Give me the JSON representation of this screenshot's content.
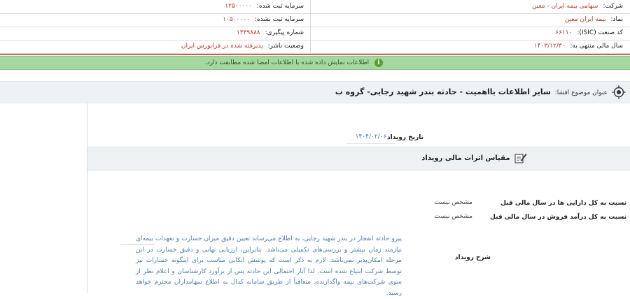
{
  "company_info": {
    "company": {
      "label": "شرکت:",
      "value": "سهامی بیمه ایران - معین"
    },
    "registered_capital": {
      "label": "سرمایه ثبت شده:",
      "value": "۱۲۵۰۰۰۰۰"
    },
    "symbol": {
      "label": "نماد:",
      "value": "بیمه ایران معین"
    },
    "unregistered_capital": {
      "label": "سرمایه ثبت نشده:",
      "value": "۱۰۵۰۰۰۰۰"
    },
    "industry_code": {
      "label": "کد صنعت (ISIC):",
      "value": "۶۶۱۱۰"
    },
    "tracking_number": {
      "label": "شماره پیگیری:",
      "value": "۱۳۳۹۸۸۸"
    },
    "fiscal_year_end": {
      "label": "سال مالی منتهی به:",
      "value": "۱۴۰۳/۱۲/۳۰"
    },
    "publisher_status": {
      "label": "وضعیت ناشر:",
      "value": "پذیرفته شده در فرابورس ایران"
    }
  },
  "notice": {
    "icon": "info-icon",
    "text": "اطلاعات نمایش داده شده با اطلاعات امضا شده مطابقت دارد."
  },
  "subject": {
    "icon": "target-icon",
    "label": "عنوان موضوع افشا:",
    "title": "سایر اطلاعات بااهمیت - حادثه بندر شهید رجایی- گروه ب"
  },
  "event": {
    "date_label": "تاریخ رویداد",
    "date_value": "۱۴۰۴/۰۲/۰۶",
    "section_icon": "pen-paper-icon",
    "section_title": "مقیاس اثرات مالی رویداد",
    "rows": [
      {
        "label": "نسبت به کل دارایی ها در سال مالی قبل",
        "value": "مشخص نیست"
      },
      {
        "label": "نسبت به کل درآمد فروش در سال مالی قبل",
        "value": "مشخص نیست"
      }
    ],
    "description_label": "شرح رویداد",
    "description": "پیرو حادثه انفجار در بندر شهید رجایی، به اطلاع می‌رساند تعیین دقیق میزان خسارت و تعهدات بیمه‌ای نیازمند زمان بیشتر و بررسی‌های تکمیلی می‌باشد. بنابراین، ارزیابی نهایی و دقیق خسارت در این مرحله امکان‌پذیر نمی‌باشد. لازم به ذکر است که پوشش اتکایی مناسب برای اینگونه خسارات نیز توسط شرکت ابتیاع شده است. لذا آثار احتمالی این حادثه پس از برآورد کارشناسان و اعلام نظر از سوی شرکت‌های بیمه واگذارنده، متعاقباً از طریق سامانه کدال به اطلاع سهامداران محترم خواهد رسید."
  },
  "colors": {
    "value_red": "#c0392b",
    "notice_green": "#a5d8a0",
    "link_blue": "#4a7cb8",
    "divider_red": "#e05a4a"
  }
}
